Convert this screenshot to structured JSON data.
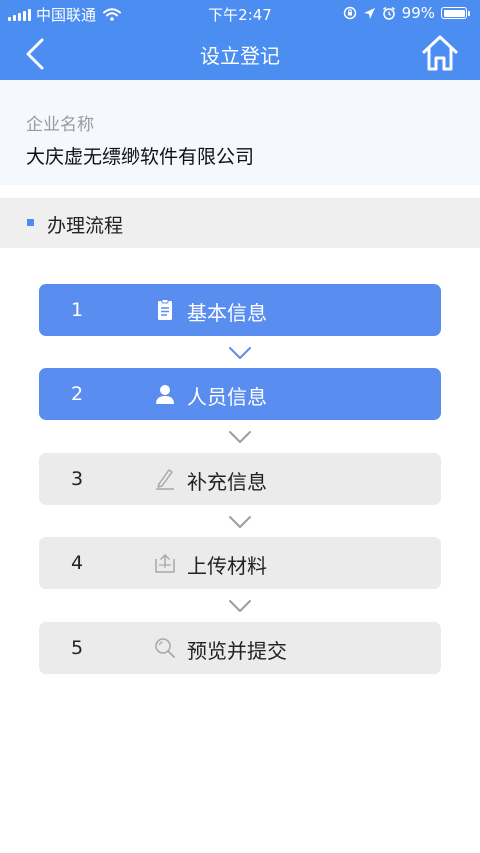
{
  "status_bar": {
    "carrier": "中国联通",
    "time": "下午2:47",
    "battery": "99%"
  },
  "nav": {
    "title": "设立登记",
    "back_icon": "chevron-left-icon",
    "home_icon": "home-icon"
  },
  "company": {
    "label": "企业名称",
    "name": "大庆虚无缥缈软件有限公司"
  },
  "section": {
    "title": "办理流程"
  },
  "steps": [
    {
      "number": "1",
      "label": "基本信息",
      "icon": "clipboard-icon",
      "state": "completed"
    },
    {
      "number": "2",
      "label": "人员信息",
      "icon": "person-icon",
      "state": "completed"
    },
    {
      "number": "3",
      "label": "补充信息",
      "icon": "pencil-icon",
      "state": "pending"
    },
    {
      "number": "4",
      "label": "上传材料",
      "icon": "upload-icon",
      "state": "pending"
    },
    {
      "number": "5",
      "label": "预览并提交",
      "icon": "search-icon",
      "state": "pending"
    }
  ],
  "colors": {
    "accent": "#4b8df0",
    "active_step": "#5a8df0",
    "inactive_step": "#ebebeb",
    "arrow": "#5a8df0"
  }
}
